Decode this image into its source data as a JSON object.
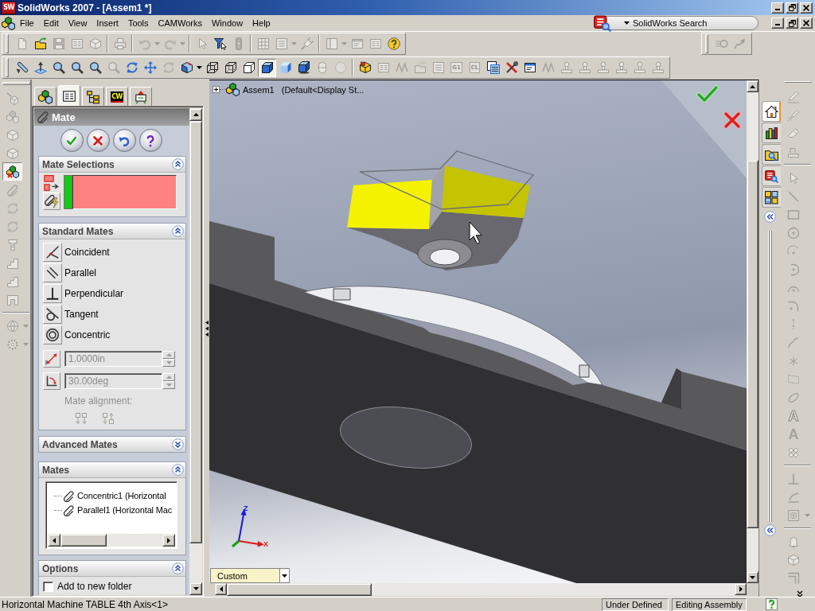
{
  "window": {
    "logo": "SW",
    "title": "SolidWorks 2007 - [Assem1 *]"
  },
  "menu_bar": {
    "items": [
      "File",
      "Edit",
      "View",
      "Insert",
      "Tools",
      "CAMWorks",
      "Window",
      "Help"
    ],
    "search": {
      "placeholder": "SolidWorks Search"
    }
  },
  "standard_toolbar": {
    "groups": [
      [
        {
          "kind": "document",
          "disabled": true
        },
        {
          "kind": "folder",
          "disabled": false
        },
        {
          "kind": "floppy",
          "disabled": true
        },
        {
          "kind": "form",
          "disabled": true
        },
        {
          "kind": "cube",
          "disabled": true
        }
      ],
      [
        {
          "kind": "printer",
          "disabled": true
        }
      ],
      [
        {
          "kind": "undo",
          "disabled": true
        },
        {
          "kind": "caret",
          "disabled": true
        },
        {
          "kind": "redo",
          "disabled": true
        },
        {
          "kind": "caret",
          "disabled": true
        }
      ],
      [
        {
          "kind": "pointer",
          "disabled": true
        },
        {
          "kind": "funnel",
          "disabled": false
        },
        {
          "kind": "traffic",
          "disabled": true
        }
      ],
      [
        {
          "kind": "grid",
          "disabled": true
        },
        {
          "kind": "list",
          "disabled": true
        },
        {
          "kind": "caret",
          "disabled": true
        },
        {
          "kind": "plug",
          "disabled": true
        }
      ],
      [
        {
          "kind": "panel",
          "disabled": true
        },
        {
          "kind": "caret",
          "disabled": true
        },
        {
          "kind": "window",
          "disabled": true
        },
        {
          "kind": "form",
          "disabled": true
        },
        {
          "kind": "help",
          "disabled": false
        }
      ]
    ]
  },
  "motion_toolbar": {
    "groups": [
      [
        {
          "kind": "speed",
          "disabled": true
        },
        {
          "kind": "curve",
          "disabled": true
        }
      ]
    ]
  },
  "view_toolbar": {
    "groups": [
      [
        {
          "kind": "tube",
          "disabled": false,
          "selected": false
        },
        {
          "kind": "plane_arrow",
          "disabled": false,
          "selected": false
        },
        {
          "kind": "magnifier",
          "disabled": false,
          "selected": false
        },
        {
          "kind": "magnifier",
          "disabled": false,
          "selected": false
        },
        {
          "kind": "magnifier",
          "disabled": false,
          "selected": false
        },
        {
          "kind": "magnifier",
          "disabled": true,
          "selected": false
        },
        {
          "kind": "rotate",
          "disabled": false,
          "selected": false
        },
        {
          "kind": "move",
          "disabled": false,
          "selected": false
        },
        {
          "kind": "rotate",
          "disabled": true,
          "selected": false
        },
        {
          "kind": "view_cube",
          "disabled": false,
          "selected": false
        },
        {
          "kind": "caret",
          "disabled": false,
          "selected": false
        },
        {
          "kind": "wire_cube",
          "disabled": false,
          "selected": false
        },
        {
          "kind": "hidden_cube",
          "disabled": false,
          "selected": false
        },
        {
          "kind": "outline_cube",
          "disabled": false,
          "selected": false
        },
        {
          "kind": "shaded_edges",
          "disabled": false,
          "selected": true
        },
        {
          "kind": "shaded",
          "disabled": false,
          "selected": false
        },
        {
          "kind": "shadow",
          "disabled": false,
          "selected": false
        },
        {
          "kind": "section",
          "disabled": true,
          "selected": false
        },
        {
          "kind": "sphere",
          "disabled": true,
          "selected": false
        }
      ],
      [
        {
          "kind": "cam_box",
          "disabled": false,
          "selected": false
        },
        {
          "kind": "form",
          "disabled": true,
          "selected": false
        },
        {
          "kind": "wave",
          "disabled": true,
          "selected": false
        },
        {
          "kind": "folder",
          "disabled": true,
          "selected": false
        },
        {
          "kind": "list",
          "disabled": true,
          "selected": false
        },
        {
          "kind": "tile",
          "text": "G1",
          "disabled": true,
          "selected": false
        },
        {
          "kind": "tile",
          "text": "CL",
          "disabled": true,
          "selected": false
        },
        {
          "kind": "table",
          "disabled": false,
          "selected": false
        },
        {
          "kind": "tools",
          "disabled": false,
          "selected": false
        },
        {
          "kind": "window",
          "disabled": false,
          "selected": false
        },
        {
          "kind": "wave",
          "disabled": true,
          "selected": false
        },
        {
          "kind": "stamp",
          "disabled": true,
          "selected": false
        },
        {
          "kind": "stamp",
          "disabled": true,
          "selected": false
        },
        {
          "kind": "stamp",
          "disabled": true,
          "selected": false
        },
        {
          "kind": "stamp",
          "disabled": true,
          "selected": false
        },
        {
          "kind": "stamp",
          "disabled": true,
          "selected": false
        },
        {
          "kind": "stamp",
          "disabled": true,
          "selected": false
        }
      ]
    ]
  },
  "assembly_toolbar": {
    "groups": [
      [
        {
          "kind": "cube_arrow",
          "disabled": true,
          "selected": false
        },
        {
          "kind": "cubes",
          "disabled": true,
          "selected": false
        },
        {
          "kind": "cube",
          "disabled": true,
          "selected": false
        },
        {
          "kind": "cube",
          "disabled": true,
          "selected": false
        },
        {
          "kind": "mate",
          "disabled": false,
          "selected": true
        },
        {
          "kind": "paperclip",
          "disabled": true,
          "selected": false
        },
        {
          "kind": "rotate",
          "disabled": true,
          "selected": false
        },
        {
          "kind": "rotate",
          "disabled": true,
          "selected": false
        },
        {
          "kind": "bolt",
          "disabled": true,
          "selected": false
        },
        {
          "kind": "stairs",
          "disabled": true,
          "selected": false
        },
        {
          "kind": "stairs",
          "disabled": true,
          "selected": false
        },
        {
          "kind": "frame",
          "disabled": true,
          "selected": false
        }
      ],
      [
        {
          "kind": "globe",
          "disabled": true,
          "selected": false
        },
        {
          "kind": "caret",
          "disabled": true,
          "selected": false
        },
        {
          "kind": "gear",
          "disabled": true,
          "selected": false
        },
        {
          "kind": "caret",
          "disabled": true,
          "selected": false
        }
      ]
    ]
  },
  "property_manager": {
    "tabs": [
      {
        "kind": "feature_tree",
        "selected": false
      },
      {
        "kind": "property",
        "selected": true
      },
      {
        "kind": "configuration",
        "selected": false
      },
      {
        "kind": "camworks",
        "text": "CW",
        "selected": false
      },
      {
        "kind": "display",
        "selected": false
      }
    ],
    "title": "Mate",
    "actions": [
      {
        "kind": "ok"
      },
      {
        "kind": "cancel"
      },
      {
        "kind": "undo"
      },
      {
        "kind": "help"
      }
    ],
    "groups": [
      {
        "kind": "selections",
        "title": "Mate Selections",
        "expanded": true,
        "selection_box": {
          "active": true
        }
      },
      {
        "kind": "standard",
        "title": "Standard Mates",
        "expanded": true,
        "mates": [
          {
            "kind": "coincident",
            "label": "Coincident",
            "selected": false
          },
          {
            "kind": "parallel",
            "label": "Parallel",
            "selected": false
          },
          {
            "kind": "perpendicular",
            "label": "Perpendicular",
            "selected": false
          },
          {
            "kind": "tangent",
            "label": "Tangent",
            "selected": false
          },
          {
            "kind": "concentric",
            "label": "Concentric",
            "selected": false
          }
        ],
        "distance": {
          "value": "1.0000in",
          "disabled": true
        },
        "angle": {
          "value": "30.00deg",
          "disabled": true
        },
        "alignment": {
          "label": "Mate alignment:",
          "disabled": true
        }
      },
      {
        "kind": "advanced",
        "title": "Advanced Mates",
        "expanded": false
      },
      {
        "kind": "mates",
        "title": "Mates",
        "expanded": true,
        "items": [
          "Concentric1 (Horizontal",
          "Parallel1 (Horizontal Mac"
        ]
      },
      {
        "kind": "options",
        "title": "Options",
        "expanded": true,
        "options": [
          {
            "label": "Add to new folder",
            "checked": false
          }
        ]
      }
    ]
  },
  "viewport": {
    "tree": {
      "name": "Assem1",
      "configuration": "(Default<Display St..."
    },
    "triad": {
      "z_label": "Z",
      "x_label": "X"
    },
    "view_orientation": {
      "value": "Custom"
    }
  },
  "task_pane": {
    "tabs": [
      {
        "kind": "home",
        "selected": true
      },
      {
        "kind": "library",
        "selected": false
      },
      {
        "kind": "explorer",
        "selected": false
      },
      {
        "kind": "search",
        "selected": false
      },
      {
        "kind": "palette",
        "selected": false
      }
    ]
  },
  "sketch_toolbar": {
    "groups": [
      [
        {
          "kind": "pencil",
          "disabled": true
        },
        {
          "kind": "pencil3d",
          "disabled": true
        },
        {
          "kind": "eraser",
          "disabled": true
        },
        {
          "kind": "ruler",
          "disabled": true
        }
      ],
      [
        {
          "kind": "pointer",
          "disabled": true
        },
        {
          "kind": "line",
          "disabled": true
        },
        {
          "kind": "rectangle",
          "disabled": true
        },
        {
          "kind": "circle",
          "disabled": true
        },
        {
          "kind": "arc_dashed",
          "disabled": true
        },
        {
          "kind": "arc_side",
          "disabled": true
        },
        {
          "kind": "arc_top",
          "disabled": true
        },
        {
          "kind": "fillet",
          "disabled": true
        },
        {
          "kind": "centerline",
          "disabled": true
        },
        {
          "kind": "spline",
          "disabled": true
        },
        {
          "kind": "point",
          "disabled": true
        },
        {
          "kind": "plane",
          "disabled": true
        },
        {
          "kind": "ellipse",
          "disabled": true
        },
        {
          "kind": "letter_outline",
          "text": "A",
          "disabled": true
        },
        {
          "kind": "letter",
          "text": "A",
          "disabled": true
        },
        {
          "kind": "cross",
          "disabled": true
        }
      ],
      [
        {
          "kind": "perpendicular",
          "disabled": true
        },
        {
          "kind": "drape",
          "disabled": true
        },
        {
          "kind": "target",
          "disabled": true
        },
        {
          "kind": "caret",
          "disabled": true
        }
      ],
      [
        {
          "kind": "bell",
          "disabled": true
        },
        {
          "kind": "cube",
          "disabled": true
        },
        {
          "kind": "offset",
          "disabled": true
        }
      ]
    ]
  },
  "status_bar": {
    "message": "Horizontal Machine TABLE 4th Axis<1>",
    "panels": [
      "Under Defined",
      "Editing Assembly"
    ]
  }
}
